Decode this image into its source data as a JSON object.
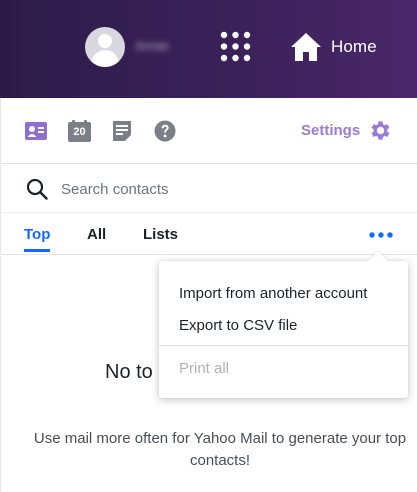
{
  "header": {
    "username": "Jonas",
    "home_label": "Home",
    "icons": [
      "avatar",
      "apps-grid-icon",
      "home-icon"
    ]
  },
  "toolbar": {
    "icons": [
      "contacts-card-icon",
      "calendar-icon",
      "notepad-icon",
      "help-icon"
    ],
    "calendar_day": "20",
    "settings_label": "Settings",
    "accent_color": "#9b7bd8"
  },
  "search": {
    "placeholder": "Search contacts"
  },
  "tabs": [
    {
      "label": "Top",
      "active": true
    },
    {
      "label": "All",
      "active": false
    },
    {
      "label": "Lists",
      "active": false
    }
  ],
  "menu": {
    "items": [
      {
        "label": "Import from another account",
        "enabled": true
      },
      {
        "label": "Export to CSV file",
        "enabled": true
      },
      {
        "label": "Print all",
        "enabled": false
      }
    ]
  },
  "empty_state": {
    "title": "No to",
    "message": "Use mail more often for Yahoo Mail to generate your top contacts!"
  },
  "colors": {
    "header_bg": "#3a2159",
    "active_tab": "#0f69ff",
    "settings": "#9b7bd8"
  }
}
